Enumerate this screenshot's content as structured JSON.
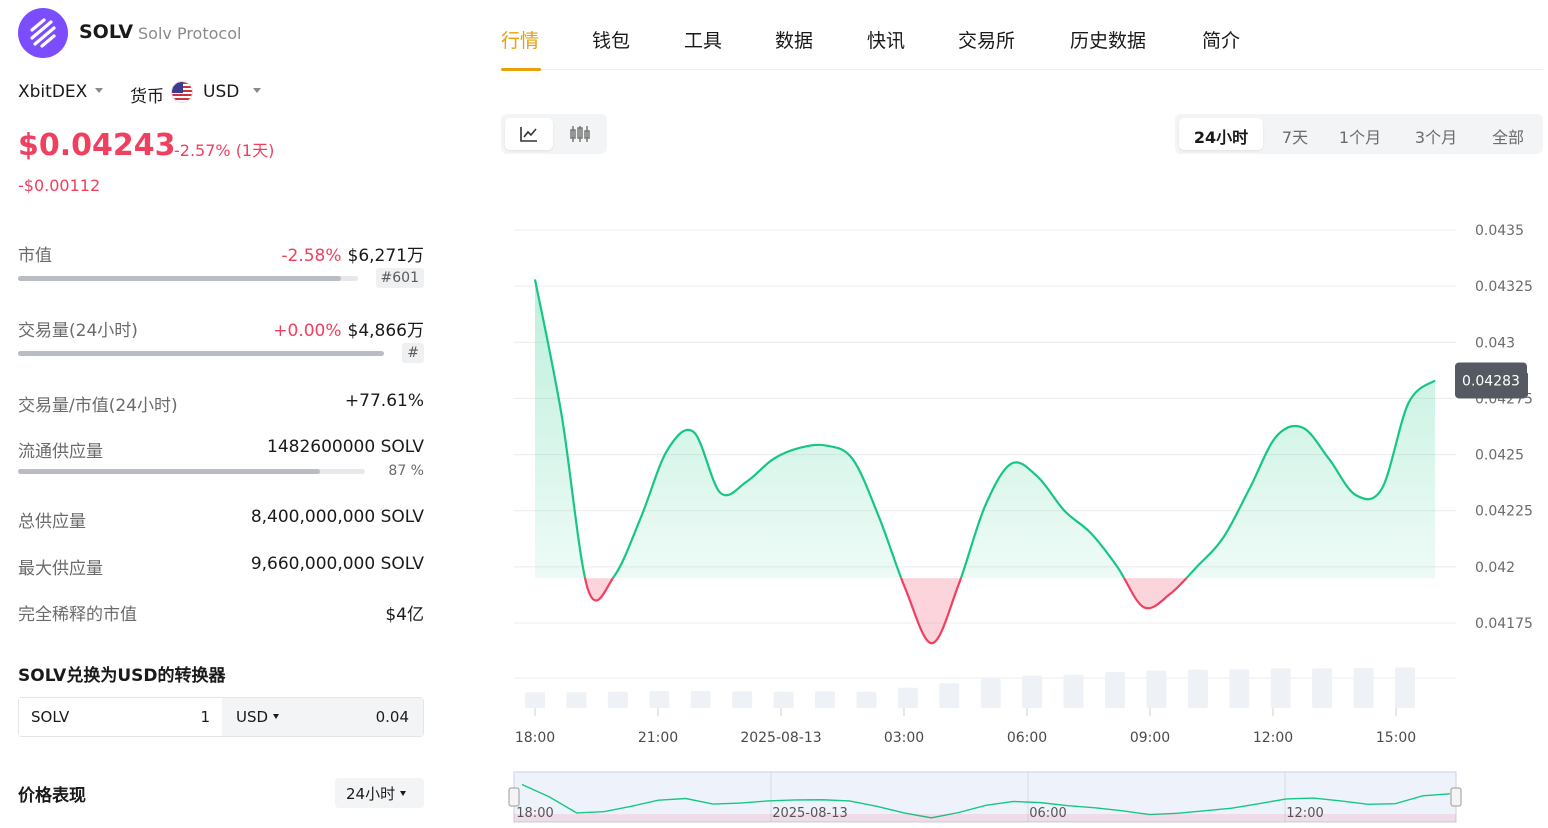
{
  "coin": {
    "symbol": "SOLV",
    "name": "Solv Protocol",
    "logo_color": "#7c4dff",
    "logo_icon": "solv-logo-icon"
  },
  "selectors": {
    "exchange": "XbitDEX",
    "currency_label": "货币",
    "currency_flag": "us-flag-icon",
    "currency": "USD"
  },
  "price": {
    "current": "$0.04243",
    "change_pct": "-2.57% (1天)",
    "change_abs": "-$0.00112",
    "negative_color": "#f03f5f",
    "positive_color": "#16c784"
  },
  "stats": {
    "market_cap": {
      "label": "市值",
      "change": "-2.58%",
      "value": "$6,271万",
      "rank": "#601",
      "bar_fraction": 0.95
    },
    "volume": {
      "label": "交易量(24小时)",
      "change": "+0.00%",
      "value": "$4,866万",
      "rank": "#",
      "bar_fraction": 1.0
    },
    "vol_mcap": {
      "label": "交易量/市值(24小时)",
      "value": "+77.61%"
    },
    "circulating": {
      "label": "流通供应量",
      "value": "1482600000 SOLV",
      "pct": "87 %",
      "bar_fraction": 0.87
    },
    "total_supply": {
      "label": "总供应量",
      "value": "8,400,000,000 SOLV"
    },
    "max_supply": {
      "label": "最大供应量",
      "value": "9,660,000,000 SOLV"
    },
    "fdv": {
      "label": "完全稀释的市值",
      "value": "$4亿"
    }
  },
  "converter": {
    "title": "SOLV兑换为USD的转换器",
    "from_symbol": "SOLV",
    "from_amount": "1",
    "to_currency": "USD",
    "to_amount": "0.04"
  },
  "performance": {
    "title": "价格表现",
    "period": "24小时"
  },
  "nav": {
    "tabs": [
      "行情",
      "钱包",
      "工具",
      "数据",
      "快讯",
      "交易所",
      "历史数据",
      "简介"
    ],
    "active_index": 0,
    "active_color": "#e6a10b"
  },
  "chart_controls": {
    "types": [
      "line-chart-icon",
      "candlestick-icon"
    ],
    "active_type": 0,
    "ranges": [
      "24小时",
      "7天",
      "1个月",
      "3个月",
      "全部"
    ],
    "active_range": 0
  },
  "chart_data": {
    "type": "area",
    "series": [
      {
        "values": [
          0.04328,
          0.04268,
          0.0419,
          0.04196,
          0.04222,
          0.04252,
          0.0426,
          0.04233,
          0.04238,
          0.04248,
          0.04253,
          0.04254,
          0.04248,
          0.04222,
          0.0419,
          0.04166,
          0.04192,
          0.04227,
          0.04246,
          0.0424,
          0.04225,
          0.04215,
          0.042,
          0.04182,
          0.04188,
          0.042,
          0.04213,
          0.04235,
          0.04258,
          0.04262,
          0.04248,
          0.04232,
          0.04235,
          0.04273,
          0.04283
        ]
      }
    ],
    "baseline": 0.04195,
    "current_value_label": "0.04283",
    "y_ticks": [
      "0.0435",
      "0.04325",
      "0.043",
      "0.04275",
      "0.0425",
      "0.04225",
      "0.042",
      "0.04175"
    ],
    "ylim": [
      0.04175,
      0.0435
    ],
    "x_ticks": [
      "18:00",
      "21:00",
      "2025-08-13",
      "03:00",
      "06:00",
      "09:00",
      "12:00",
      "15:00"
    ],
    "volume": [
      0.35,
      0.35,
      0.36,
      0.38,
      0.38,
      0.37,
      0.36,
      0.37,
      0.36,
      0.45,
      0.55,
      0.65,
      0.72,
      0.74,
      0.8,
      0.83,
      0.85,
      0.86,
      0.88,
      0.88,
      0.89,
      0.9
    ],
    "navigator_ticks": [
      "18:00",
      "2025-08-13",
      "06:00",
      "12:00"
    ],
    "up_color": "#16c784",
    "down_color": "#f03f5f",
    "grid": true
  }
}
